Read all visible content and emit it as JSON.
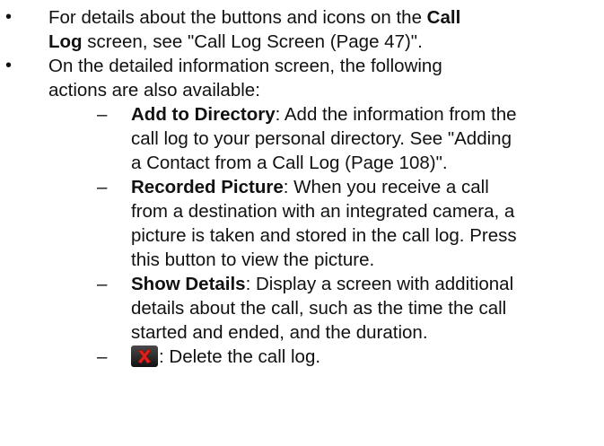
{
  "bullets": [
    {
      "lines": [
        {
          "pre": "For details about the buttons and icons on the ",
          "bold": "Call",
          "post": ""
        },
        {
          "pre": "",
          "bold": "Log",
          "post": " screen, see \"Call Log Screen (Page 47)\"."
        }
      ]
    },
    {
      "lines": [
        {
          "pre": "On the detailed information screen, the following",
          "bold": "",
          "post": ""
        },
        {
          "pre": "actions are also available:",
          "bold": "",
          "post": ""
        }
      ]
    }
  ],
  "sub_items": [
    {
      "lines": [
        {
          "pre": "",
          "bold": "Add to Directory",
          "post": ": Add the information from the"
        },
        {
          "pre": "call log to your personal directory. See \"Adding",
          "bold": "",
          "post": ""
        },
        {
          "pre": "a Contact from a Call Log (Page 108)\".",
          "bold": "",
          "post": ""
        }
      ]
    },
    {
      "lines": [
        {
          "pre": "",
          "bold": "Recorded Picture",
          "post": ": When you receive a call"
        },
        {
          "pre": "from a destination with an integrated camera, a",
          "bold": "",
          "post": ""
        },
        {
          "pre": "picture is taken and stored in the call log. Press",
          "bold": "",
          "post": ""
        },
        {
          "pre": "this button to view the picture.",
          "bold": "",
          "post": ""
        }
      ]
    },
    {
      "lines": [
        {
          "pre": "",
          "bold": "Show Details",
          "post": ": Display a screen with additional"
        },
        {
          "pre": "details about the call, such as the time the call",
          "bold": "",
          "post": ""
        },
        {
          "pre": "started and ended, and the duration.",
          "bold": "",
          "post": ""
        }
      ]
    }
  ],
  "delete_item": {
    "icon": "delete-x-icon",
    "text": ": Delete the call log."
  },
  "bullet_glyph": "•",
  "dash_glyph": "–",
  "colors": {
    "text": "#111111",
    "delete_icon_x": "#e0201b",
    "delete_icon_bg": "#2a2a2a"
  }
}
